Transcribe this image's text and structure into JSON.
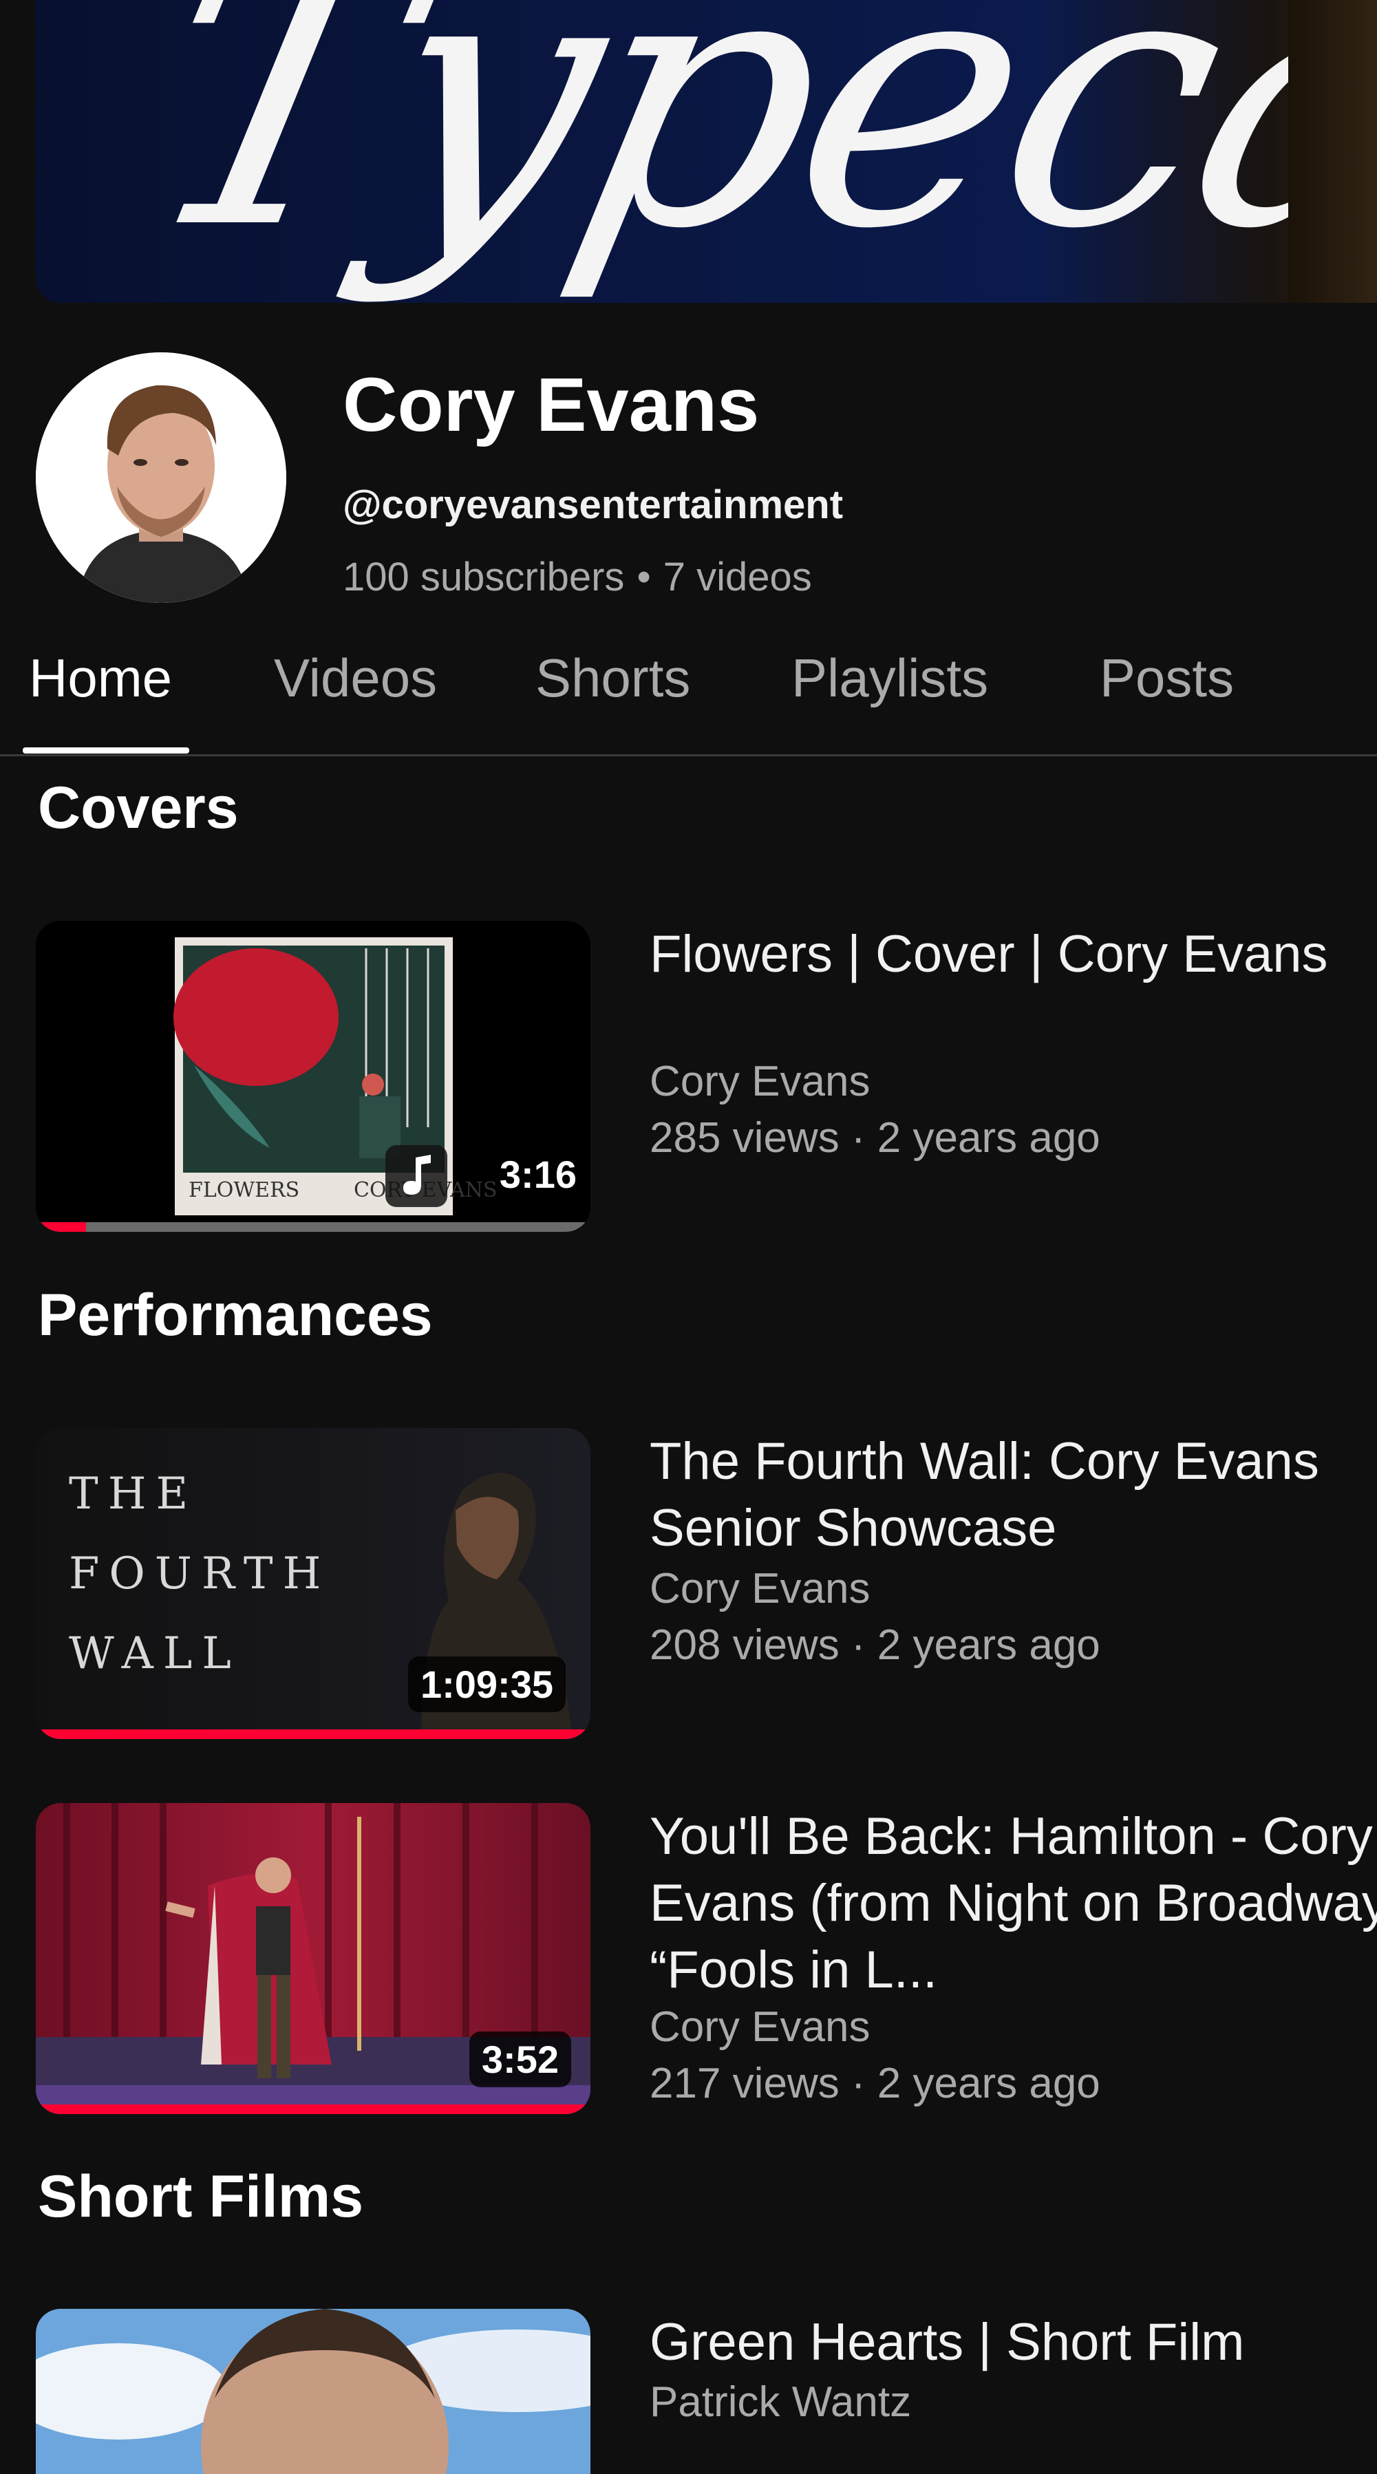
{
  "banner": {
    "text": "Typecast"
  },
  "channel": {
    "name": "Cory Evans",
    "handle": "@coryevansentertainment",
    "subscribers": "100 subscribers",
    "separator": "•",
    "videos": "7 videos"
  },
  "tabs": [
    {
      "label": "Home",
      "active": true
    },
    {
      "label": "Videos",
      "active": false
    },
    {
      "label": "Shorts",
      "active": false
    },
    {
      "label": "Playlists",
      "active": false
    },
    {
      "label": "Posts",
      "active": false
    }
  ],
  "sections": [
    {
      "title": "Covers",
      "videos": [
        {
          "title": "Flowers | Cover | Cory Evans",
          "channel": "Cory Evans",
          "meta": "285 views · 2 years ago",
          "duration": "3:16",
          "watched_fraction": 0.09,
          "thumb_text_left": "FLOWERS",
          "thumb_text_right": "CORY EVANS"
        }
      ]
    },
    {
      "title": "Performances",
      "videos": [
        {
          "title": "The Fourth Wall: Cory Evans Senior Showcase",
          "channel": "Cory Evans",
          "meta": "208 views · 2 years ago",
          "duration": "1:09:35",
          "watched_fraction": 1.0,
          "thumb_lines": [
            "THE",
            "FOURTH",
            "WALL"
          ]
        },
        {
          "title": "You'll Be Back: Hamilton - Cory Evans (from Night on Broadway “Fools in L...",
          "channel": "Cory Evans",
          "meta": "217 views · 2 years ago",
          "duration": "3:52",
          "watched_fraction": 1.0
        }
      ]
    },
    {
      "title": "Short Films",
      "videos": [
        {
          "title": "Green Hearts | Short Film",
          "channel": "Patrick Wantz"
        }
      ]
    }
  ],
  "colors": {
    "background": "#0f0f0f",
    "progress": "#ff0033",
    "secondary_text": "#aaaaaa"
  }
}
